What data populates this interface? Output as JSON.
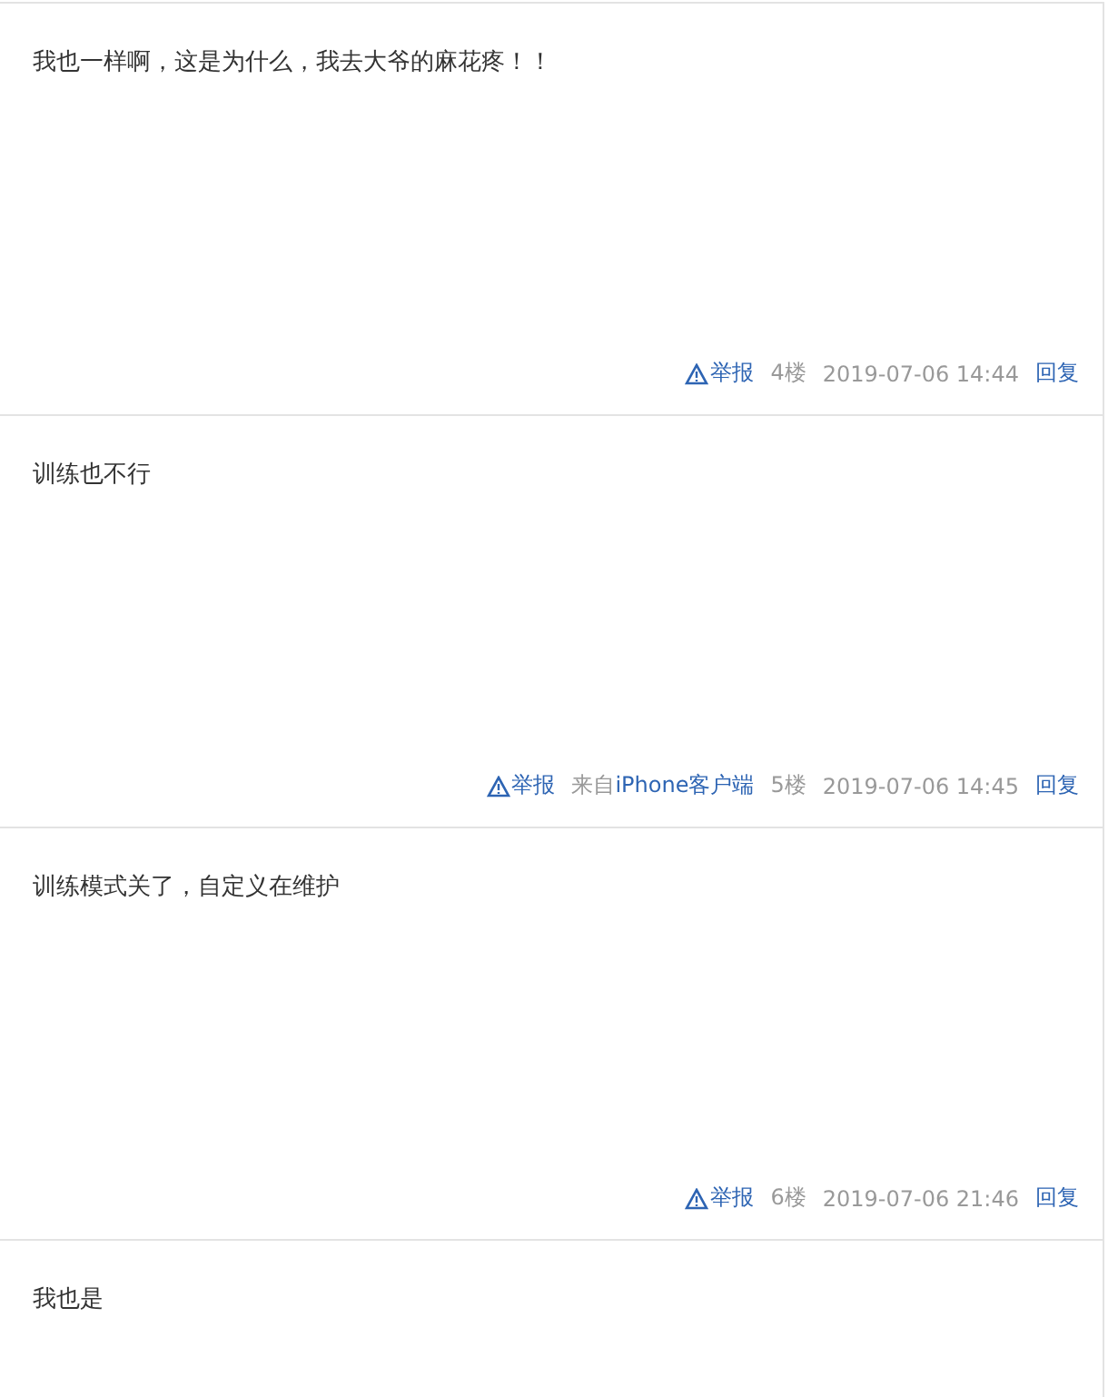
{
  "posts": [
    {
      "content": "我也一样啊，这是为什么，我去大爷的麻花疼！！",
      "report": "举报",
      "floor": "4楼",
      "time": "2019-07-06 14:44",
      "reply": "回复"
    },
    {
      "content": "训练也不行",
      "report": "举报",
      "source_prefix": "来自",
      "source_link": "iPhone客户端",
      "floor": "5楼",
      "time": "2019-07-06 14:45",
      "reply": "回复"
    },
    {
      "content": "训练模式关了，自定义在维护",
      "report": "举报",
      "floor": "6楼",
      "time": "2019-07-06 21:46",
      "reply": "回复"
    },
    {
      "content": "我也是"
    }
  ]
}
